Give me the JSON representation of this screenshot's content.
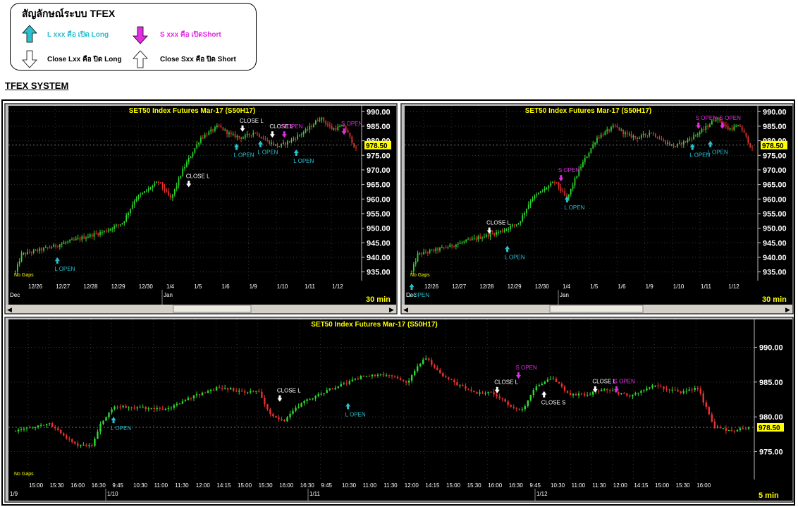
{
  "legend": {
    "title": "สัญลักษณ์ระบบ TFEX",
    "open_long": "L xxx คือ เปิด Long",
    "open_short": "S xxx คือ เปิดShort",
    "close_long": "Close Lxx คือ ปิด Long",
    "close_short": "Close Sxx คือ ปิด Short",
    "colors": {
      "open_long": "#29bfcf",
      "open_short": "#e02ee0"
    }
  },
  "section_title": "TFEX SYSTEM",
  "charts_meta": {
    "background": "#000000",
    "up_color": "#2edc2e",
    "down_color": "#ee3030",
    "no_gaps_label": "No Gaps",
    "last_price_label": "978.50"
  },
  "chart_data": [
    {
      "type": "candlestick",
      "title": "SET50  Index  Futures  Mar-17  (S50H17)",
      "interval": "30  min",
      "y_ticks": [
        "990.00",
        "985.00",
        "980.00",
        "975.00",
        "970.00",
        "965.00",
        "960.00",
        "955.00",
        "950.00",
        "945.00",
        "940.00",
        "935.00"
      ],
      "ylim": [
        932,
        992
      ],
      "x_tick_labels": [
        "12/26",
        "12/27",
        "12/28",
        "12/29",
        "12/30",
        "1/4",
        "1/5",
        "1/6",
        "1/9",
        "1/10",
        "1/11",
        "1/12"
      ],
      "month_labels": [
        "Dec",
        "Jan"
      ],
      "close_path": [
        [
          0,
          935
        ],
        [
          1,
          941
        ],
        [
          5,
          943
        ],
        [
          10,
          946
        ],
        [
          15,
          949
        ],
        [
          18,
          952
        ],
        [
          20,
          960
        ],
        [
          24,
          966
        ],
        [
          26,
          960
        ],
        [
          28,
          970
        ],
        [
          31,
          981
        ],
        [
          34,
          985
        ],
        [
          36,
          982
        ],
        [
          38,
          981
        ],
        [
          40,
          983
        ],
        [
          42,
          980
        ],
        [
          44,
          978
        ],
        [
          46,
          980
        ],
        [
          49,
          984
        ],
        [
          51,
          988
        ],
        [
          53,
          984
        ],
        [
          55,
          985
        ],
        [
          57,
          977
        ]
      ],
      "signals": [
        {
          "text": "L  OPEN",
          "kind": "open_long",
          "x": 7,
          "y": 940
        },
        {
          "text": "CLOSE  L",
          "kind": "close_long",
          "x": 29,
          "y": 966
        },
        {
          "text": "CLOSE  L",
          "kind": "close_long",
          "x": 38,
          "y": 985
        },
        {
          "text": "L  OPEN",
          "kind": "open_long",
          "x": 37,
          "y": 979
        },
        {
          "text": "L  OPEN",
          "kind": "open_long",
          "x": 41,
          "y": 980
        },
        {
          "text": "CLOSE  L",
          "kind": "close_long",
          "x": 43,
          "y": 983
        },
        {
          "text": "S  OPEN",
          "kind": "open_short",
          "x": 45,
          "y": 983
        },
        {
          "text": "L  OPEN",
          "kind": "open_long",
          "x": 47,
          "y": 977
        },
        {
          "text": "S  OPEN",
          "kind": "open_short",
          "x": 55,
          "y": 984
        }
      ]
    },
    {
      "type": "candlestick",
      "title": "SET50  Index  Futures  Mar-17  (S50H17)",
      "interval": "30  min",
      "y_ticks": [
        "990.00",
        "985.00",
        "980.00",
        "975.00",
        "970.00",
        "965.00",
        "960.00",
        "955.00",
        "950.00",
        "945.00",
        "940.00",
        "935.00"
      ],
      "ylim": [
        932,
        992
      ],
      "x_tick_labels": [
        "12/26",
        "12/27",
        "12/28",
        "12/29",
        "12/30",
        "1/4",
        "1/5",
        "1/6",
        "1/9",
        "1/10",
        "1/11",
        "1/12"
      ],
      "month_labels": [
        "Dec",
        "Jan"
      ],
      "close_path": [
        [
          0,
          935
        ],
        [
          1,
          941
        ],
        [
          5,
          943
        ],
        [
          10,
          946
        ],
        [
          15,
          949
        ],
        [
          18,
          952
        ],
        [
          20,
          960
        ],
        [
          24,
          966
        ],
        [
          26,
          960
        ],
        [
          28,
          970
        ],
        [
          31,
          981
        ],
        [
          34,
          985
        ],
        [
          36,
          982
        ],
        [
          38,
          981
        ],
        [
          40,
          983
        ],
        [
          42,
          980
        ],
        [
          44,
          978
        ],
        [
          46,
          980
        ],
        [
          49,
          984
        ],
        [
          51,
          988
        ],
        [
          53,
          984
        ],
        [
          55,
          985
        ],
        [
          57,
          977
        ]
      ],
      "signals": [
        {
          "text": "L  OPEN",
          "kind": "open_long",
          "x": 0,
          "y": 931
        },
        {
          "text": "CLOSE  L",
          "kind": "close_long",
          "x": 13,
          "y": 950
        },
        {
          "text": "L  OPEN",
          "kind": "open_long",
          "x": 16,
          "y": 944
        },
        {
          "text": "S  OPEN",
          "kind": "open_short",
          "x": 25,
          "y": 968
        },
        {
          "text": "L  OPEN",
          "kind": "open_long",
          "x": 26,
          "y": 961
        },
        {
          "text": "S  OPEN",
          "kind": "open_short",
          "x": 48,
          "y": 986
        },
        {
          "text": "L  OPEN",
          "kind": "open_long",
          "x": 47,
          "y": 979
        },
        {
          "text": "L  OPEN",
          "kind": "open_long",
          "x": 50,
          "y": 980
        },
        {
          "text": "S  OPEN",
          "kind": "open_short",
          "x": 52,
          "y": 986
        }
      ]
    },
    {
      "type": "candlestick",
      "title": "SET50  Index  Futures  Mar-17  (S50H17)",
      "interval": "5  min",
      "y_ticks": [
        "990.00",
        "985.00",
        "980.00",
        "975.00"
      ],
      "ylim": [
        971,
        994
      ],
      "x_tick_labels": [
        "15:00",
        "15:30",
        "16:00",
        "16:30",
        "9:45",
        "10:30",
        "11:00",
        "11:30",
        "12:00",
        "14:15",
        "15:00",
        "15:30",
        "16:00",
        "16:30",
        "9:45",
        "10:30",
        "11:00",
        "11:30",
        "12:00",
        "14:15",
        "15:00",
        "15:30",
        "16:00",
        "16:30",
        "9:45",
        "10:30",
        "11:00",
        "11:30",
        "12:00",
        "14:15",
        "15:00",
        "15:30",
        "16:00"
      ],
      "date_labels": [
        "1/9",
        "1/10",
        "1/11",
        "1/12"
      ],
      "close_path": [
        [
          0,
          978
        ],
        [
          8,
          979
        ],
        [
          14,
          976
        ],
        [
          18,
          976
        ],
        [
          20,
          979
        ],
        [
          23,
          981.5
        ],
        [
          30,
          981.3
        ],
        [
          35,
          981
        ],
        [
          42,
          983
        ],
        [
          48,
          984.3
        ],
        [
          54,
          983.5
        ],
        [
          57,
          983.8
        ],
        [
          60,
          980
        ],
        [
          63,
          979.5
        ],
        [
          67,
          982
        ],
        [
          72,
          983.5
        ],
        [
          76,
          984.5
        ],
        [
          82,
          986
        ],
        [
          88,
          986
        ],
        [
          92,
          985
        ],
        [
          96,
          988.7
        ],
        [
          100,
          986
        ],
        [
          104,
          984.5
        ],
        [
          108,
          983.5
        ],
        [
          112,
          983.5
        ],
        [
          116,
          981.5
        ],
        [
          119,
          981
        ],
        [
          122,
          984.5
        ],
        [
          126,
          985.5
        ],
        [
          130,
          983.2
        ],
        [
          134,
          983.2
        ],
        [
          138,
          984
        ],
        [
          144,
          983
        ],
        [
          150,
          984.5
        ],
        [
          156,
          983.5
        ],
        [
          160,
          984.2
        ],
        [
          164,
          978.5
        ],
        [
          168,
          978
        ],
        [
          172,
          978.5
        ]
      ],
      "signals": [
        {
          "text": "L  OPEN",
          "kind": "open_long",
          "x": 23,
          "y": 980
        },
        {
          "text": "CLOSE  L",
          "kind": "close_long",
          "x": 62,
          "y": 983
        },
        {
          "text": "L  OPEN",
          "kind": "open_long",
          "x": 78,
          "y": 982
        },
        {
          "text": "CLOSE  L",
          "kind": "close_long",
          "x": 113,
          "y": 984.2
        },
        {
          "text": "S  OPEN",
          "kind": "open_short",
          "x": 118,
          "y": 986.3
        },
        {
          "text": "CLOSE  S",
          "kind": "close_short",
          "x": 124,
          "y": 983.7
        },
        {
          "text": "CLOSE  L",
          "kind": "close_long",
          "x": 136,
          "y": 984.3
        },
        {
          "text": "S  OPEN",
          "kind": "open_short",
          "x": 141,
          "y": 984.3
        }
      ]
    }
  ]
}
